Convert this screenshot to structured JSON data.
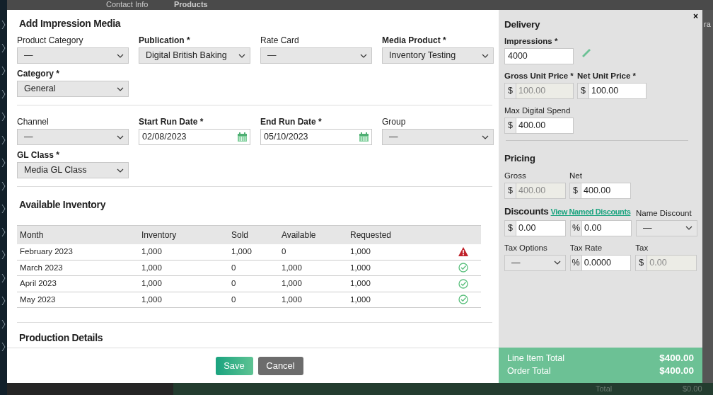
{
  "background": {
    "tabs": [
      "Contact Info",
      "Products"
    ],
    "side_text": "ra",
    "footer_label": "Total",
    "footer_value": "$0.00"
  },
  "modal": {
    "title": "Add Impression Media",
    "sections": [
      {
        "fields": [
          {
            "label": "Product Category",
            "required": false,
            "kind": "select",
            "value": "—"
          },
          {
            "label": "Publication *",
            "required": true,
            "kind": "select",
            "value": "Digital British Baking"
          },
          {
            "label": "Rate Card",
            "required": false,
            "kind": "select",
            "value": "—"
          },
          {
            "label": "Media Product *",
            "required": true,
            "kind": "select",
            "value": "Inventory Testing"
          },
          {
            "label": "Category *",
            "required": true,
            "kind": "select",
            "value": "General"
          }
        ]
      },
      {
        "fields": [
          {
            "label": "Channel",
            "required": false,
            "kind": "select",
            "value": "—"
          },
          {
            "label": "Start Run Date *",
            "required": true,
            "kind": "date",
            "value": "02/08/2023"
          },
          {
            "label": "End Run Date *",
            "required": true,
            "kind": "date",
            "value": "05/10/2023"
          },
          {
            "label": "Group",
            "required": false,
            "kind": "select",
            "value": "—"
          },
          {
            "label": "GL Class *",
            "required": true,
            "kind": "select",
            "value": "Media GL Class"
          }
        ]
      }
    ],
    "inventory": {
      "title": "Available Inventory",
      "columns": [
        "Month",
        "Inventory",
        "Sold",
        "Available",
        "Requested"
      ],
      "rows": [
        {
          "cells": [
            "February 2023",
            "1,000",
            "1,000",
            "0",
            "1,000"
          ],
          "kind": "warning"
        },
        {
          "cells": [
            "March 2023",
            "1,000",
            "0",
            "1,000",
            "1,000"
          ],
          "kind": "ok"
        },
        {
          "cells": [
            "April 2023",
            "1,000",
            "0",
            "1,000",
            "1,000"
          ],
          "kind": "ok"
        },
        {
          "cells": [
            "May 2023",
            "1,000",
            "0",
            "1,000",
            "1,000"
          ],
          "kind": "ok"
        }
      ]
    },
    "production_title": "Production Details",
    "buttons": [
      {
        "label": "Save",
        "kind": "primary"
      },
      {
        "label": "Cancel",
        "kind": "secondary"
      }
    ],
    "close": "×",
    "side": {
      "delivery_title": "Delivery",
      "delivery_rows": [
        {
          "fields": [
            {
              "label": "Impressions *",
              "required": true,
              "kind": "text",
              "value": "4000",
              "editable_icon": true
            }
          ]
        },
        {
          "fields": [
            {
              "label": "Gross Unit Price *",
              "required": true,
              "kind": "prefix",
              "prefix": "$",
              "value": "100.00",
              "disabled": true
            },
            {
              "label": "Net Unit Price *",
              "required": true,
              "kind": "prefix",
              "prefix": "$",
              "value": "100.00",
              "disabled": false
            }
          ]
        },
        {
          "fields": [
            {
              "label": "Max Digital Spend",
              "required": false,
              "kind": "prefix",
              "prefix": "$",
              "value": "400.00",
              "disabled": false
            }
          ]
        }
      ],
      "pricing_title": "Pricing",
      "pricing_rows": [
        {
          "fields": [
            {
              "label": "Gross",
              "required": false,
              "kind": "prefix",
              "prefix": "$",
              "value": "400.00",
              "disabled": true
            },
            {
              "label": "Net",
              "required": false,
              "kind": "prefix",
              "prefix": "$",
              "value": "400.00",
              "disabled": false
            }
          ]
        }
      ],
      "discounts_title": "Discounts",
      "discounts_link": "View Named Discounts",
      "discount_fields": [
        {
          "kind": "prefix",
          "prefix": "$",
          "value": "0.00",
          "disabled": false
        },
        {
          "kind": "prefix",
          "prefix": "%",
          "value": "0.00",
          "disabled": false
        },
        {
          "label": "Name Discount",
          "required": false,
          "kind": "select",
          "value": "—"
        }
      ],
      "tax_fields": [
        {
          "label": "Tax Options",
          "required": false,
          "kind": "select",
          "value": "—"
        },
        {
          "label": "Tax Rate",
          "required": false,
          "kind": "prefix",
          "prefix": "%",
          "value": "0.0000",
          "disabled": false
        },
        {
          "label": "Tax",
          "required": false,
          "kind": "prefix",
          "prefix": "$",
          "value": "0.00",
          "disabled": true
        }
      ],
      "totals": [
        {
          "label": "Line Item Total",
          "value": "$400.00"
        },
        {
          "label": "Order Total",
          "value": "$400.00"
        }
      ]
    }
  }
}
